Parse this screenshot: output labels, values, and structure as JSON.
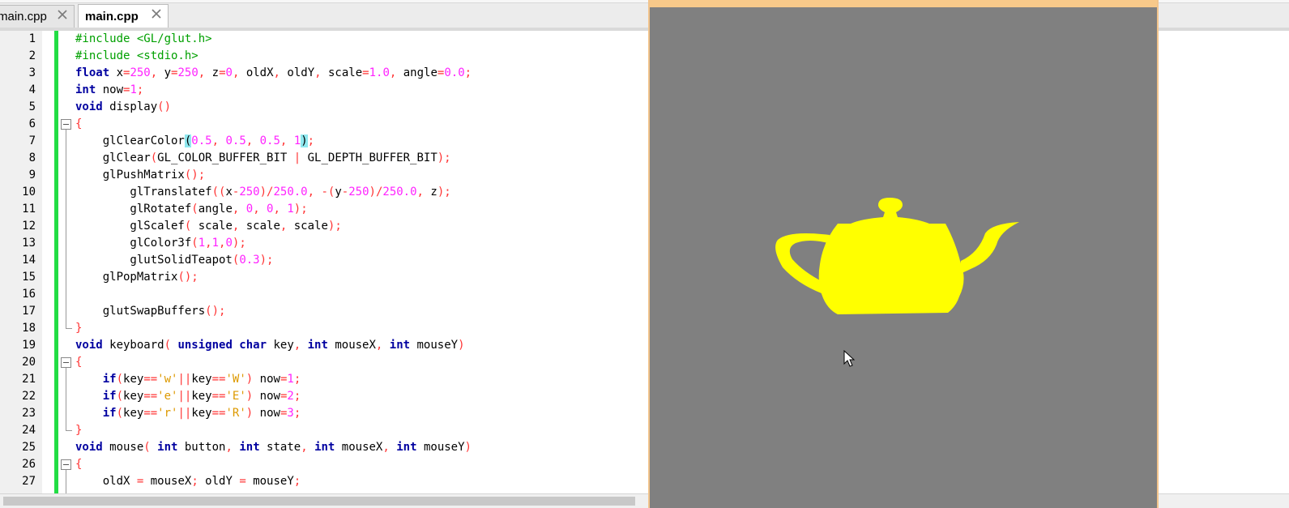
{
  "tabs": [
    {
      "label": "main.cpp",
      "state": "inactive"
    },
    {
      "label": "main.cpp",
      "state": "active"
    }
  ],
  "editor": {
    "lines": [
      {
        "n": "1",
        "tokens": [
          [
            "pp",
            "#include <GL/glut.h>"
          ]
        ]
      },
      {
        "n": "2",
        "tokens": [
          [
            "pp",
            "#include <stdio.h>"
          ]
        ]
      },
      {
        "n": "3",
        "tokens": [
          [
            "kw",
            "float"
          ],
          [
            "t",
            " x"
          ],
          [
            "op",
            "="
          ],
          [
            "num",
            "250"
          ],
          [
            "op",
            ","
          ],
          [
            "t",
            " y"
          ],
          [
            "op",
            "="
          ],
          [
            "num",
            "250"
          ],
          [
            "op",
            ","
          ],
          [
            "t",
            " z"
          ],
          [
            "op",
            "="
          ],
          [
            "num",
            "0"
          ],
          [
            "op",
            ","
          ],
          [
            "t",
            " oldX"
          ],
          [
            "op",
            ","
          ],
          [
            "t",
            " oldY"
          ],
          [
            "op",
            ","
          ],
          [
            "t",
            " scale"
          ],
          [
            "op",
            "="
          ],
          [
            "num",
            "1.0"
          ],
          [
            "op",
            ","
          ],
          [
            "t",
            " angle"
          ],
          [
            "op",
            "="
          ],
          [
            "num",
            "0.0"
          ],
          [
            "op",
            ";"
          ]
        ]
      },
      {
        "n": "4",
        "tokens": [
          [
            "kw",
            "int"
          ],
          [
            "t",
            " now"
          ],
          [
            "op",
            "="
          ],
          [
            "num",
            "1"
          ],
          [
            "op",
            ";"
          ]
        ]
      },
      {
        "n": "5",
        "tokens": [
          [
            "kw",
            "void"
          ],
          [
            "t",
            " display"
          ],
          [
            "op",
            "()"
          ]
        ]
      },
      {
        "n": "6",
        "tokens": [
          [
            "op",
            "{"
          ]
        ],
        "fold": "start"
      },
      {
        "n": "7",
        "tokens": [
          [
            "t",
            "    glClearColor"
          ],
          [
            "hl",
            "("
          ],
          [
            "num",
            "0.5"
          ],
          [
            "op",
            ","
          ],
          [
            "num",
            " 0.5"
          ],
          [
            "op",
            ","
          ],
          [
            "num",
            " 0.5"
          ],
          [
            "op",
            ","
          ],
          [
            "num",
            " 1"
          ],
          [
            "hl",
            ")"
          ],
          [
            "op",
            ";"
          ]
        ]
      },
      {
        "n": "8",
        "tokens": [
          [
            "t",
            "    glClear"
          ],
          [
            "op",
            "("
          ],
          [
            "t",
            "GL_COLOR_BUFFER_BIT "
          ],
          [
            "op",
            "|"
          ],
          [
            "t",
            " GL_DEPTH_BUFFER_BIT"
          ],
          [
            "op",
            ");"
          ]
        ]
      },
      {
        "n": "9",
        "tokens": [
          [
            "t",
            "    glPushMatrix"
          ],
          [
            "op",
            "();"
          ]
        ]
      },
      {
        "n": "10",
        "tokens": [
          [
            "t",
            "        glTranslatef"
          ],
          [
            "op",
            "(("
          ],
          [
            "t",
            "x"
          ],
          [
            "op",
            "-"
          ],
          [
            "num",
            "250"
          ],
          [
            "op",
            ")/"
          ],
          [
            "num",
            "250.0"
          ],
          [
            "op",
            ","
          ],
          [
            "op",
            " -("
          ],
          [
            "t",
            "y"
          ],
          [
            "op",
            "-"
          ],
          [
            "num",
            "250"
          ],
          [
            "op",
            ")/"
          ],
          [
            "num",
            "250.0"
          ],
          [
            "op",
            ","
          ],
          [
            "t",
            " z"
          ],
          [
            "op",
            ");"
          ]
        ]
      },
      {
        "n": "11",
        "tokens": [
          [
            "t",
            "        glRotatef"
          ],
          [
            "op",
            "("
          ],
          [
            "t",
            "angle"
          ],
          [
            "op",
            ","
          ],
          [
            "num",
            " 0"
          ],
          [
            "op",
            ","
          ],
          [
            "num",
            " 0"
          ],
          [
            "op",
            ","
          ],
          [
            "num",
            " 1"
          ],
          [
            "op",
            ");"
          ]
        ]
      },
      {
        "n": "12",
        "tokens": [
          [
            "t",
            "        glScalef"
          ],
          [
            "op",
            "("
          ],
          [
            "t",
            " scale"
          ],
          [
            "op",
            ","
          ],
          [
            "t",
            " scale"
          ],
          [
            "op",
            ","
          ],
          [
            "t",
            " scale"
          ],
          [
            "op",
            ");"
          ]
        ]
      },
      {
        "n": "13",
        "tokens": [
          [
            "t",
            "        glColor3f"
          ],
          [
            "op",
            "("
          ],
          [
            "num",
            "1"
          ],
          [
            "op",
            ","
          ],
          [
            "num",
            "1"
          ],
          [
            "op",
            ","
          ],
          [
            "num",
            "0"
          ],
          [
            "op",
            ");"
          ]
        ]
      },
      {
        "n": "14",
        "tokens": [
          [
            "t",
            "        glutSolidTeapot"
          ],
          [
            "op",
            "("
          ],
          [
            "num",
            "0.3"
          ],
          [
            "op",
            ");"
          ]
        ]
      },
      {
        "n": "15",
        "tokens": [
          [
            "t",
            "    glPopMatrix"
          ],
          [
            "op",
            "();"
          ]
        ]
      },
      {
        "n": "16",
        "tokens": []
      },
      {
        "n": "17",
        "tokens": [
          [
            "t",
            "    glutSwapBuffers"
          ],
          [
            "op",
            "();"
          ]
        ]
      },
      {
        "n": "18",
        "tokens": [
          [
            "op",
            "}"
          ]
        ],
        "fold": "end"
      },
      {
        "n": "19",
        "tokens": [
          [
            "kw",
            "void"
          ],
          [
            "t",
            " keyboard"
          ],
          [
            "op",
            "("
          ],
          [
            "kw",
            " unsigned char"
          ],
          [
            "t",
            " key"
          ],
          [
            "op",
            ","
          ],
          [
            "kw",
            " int"
          ],
          [
            "t",
            " mouseX"
          ],
          [
            "op",
            ","
          ],
          [
            "kw",
            " int"
          ],
          [
            "t",
            " mouseY"
          ],
          [
            "op",
            ")"
          ]
        ]
      },
      {
        "n": "20",
        "tokens": [
          [
            "op",
            "{"
          ]
        ],
        "fold": "start"
      },
      {
        "n": "21",
        "tokens": [
          [
            "kw",
            "    if"
          ],
          [
            "op",
            "("
          ],
          [
            "t",
            "key"
          ],
          [
            "op",
            "=="
          ],
          [
            "str",
            "'w'"
          ],
          [
            "op",
            "||"
          ],
          [
            "t",
            "key"
          ],
          [
            "op",
            "=="
          ],
          [
            "str",
            "'W'"
          ],
          [
            "op",
            ")"
          ],
          [
            "t",
            " now"
          ],
          [
            "op",
            "="
          ],
          [
            "num",
            "1"
          ],
          [
            "op",
            ";"
          ]
        ]
      },
      {
        "n": "22",
        "tokens": [
          [
            "kw",
            "    if"
          ],
          [
            "op",
            "("
          ],
          [
            "t",
            "key"
          ],
          [
            "op",
            "=="
          ],
          [
            "str",
            "'e'"
          ],
          [
            "op",
            "||"
          ],
          [
            "t",
            "key"
          ],
          [
            "op",
            "=="
          ],
          [
            "str",
            "'E'"
          ],
          [
            "op",
            ")"
          ],
          [
            "t",
            " now"
          ],
          [
            "op",
            "="
          ],
          [
            "num",
            "2"
          ],
          [
            "op",
            ";"
          ]
        ]
      },
      {
        "n": "23",
        "tokens": [
          [
            "kw",
            "    if"
          ],
          [
            "op",
            "("
          ],
          [
            "t",
            "key"
          ],
          [
            "op",
            "=="
          ],
          [
            "str",
            "'r'"
          ],
          [
            "op",
            "||"
          ],
          [
            "t",
            "key"
          ],
          [
            "op",
            "=="
          ],
          [
            "str",
            "'R'"
          ],
          [
            "op",
            ")"
          ],
          [
            "t",
            " now"
          ],
          [
            "op",
            "="
          ],
          [
            "num",
            "3"
          ],
          [
            "op",
            ";"
          ]
        ]
      },
      {
        "n": "24",
        "tokens": [
          [
            "op",
            "}"
          ]
        ],
        "fold": "end"
      },
      {
        "n": "25",
        "tokens": [
          [
            "kw",
            "void"
          ],
          [
            "t",
            " mouse"
          ],
          [
            "op",
            "("
          ],
          [
            "kw",
            " int"
          ],
          [
            "t",
            " button"
          ],
          [
            "op",
            ","
          ],
          [
            "kw",
            " int"
          ],
          [
            "t",
            " state"
          ],
          [
            "op",
            ","
          ],
          [
            "kw",
            " int"
          ],
          [
            "t",
            " mouseX"
          ],
          [
            "op",
            ","
          ],
          [
            "kw",
            " int"
          ],
          [
            "t",
            " mouseY"
          ],
          [
            "op",
            ")"
          ]
        ]
      },
      {
        "n": "26",
        "tokens": [
          [
            "op",
            "{"
          ]
        ],
        "fold": "start"
      },
      {
        "n": "27",
        "tokens": [
          [
            "t",
            "    oldX "
          ],
          [
            "op",
            "="
          ],
          [
            "t",
            " mouseX"
          ],
          [
            "op",
            ";"
          ],
          [
            "t",
            " oldY "
          ],
          [
            "op",
            "="
          ],
          [
            "t",
            " mouseY"
          ],
          [
            "op",
            ";"
          ]
        ]
      }
    ]
  },
  "gl_window": {
    "background": "#808080",
    "teapot_color": "#ffff00",
    "titlebar_color": "#f8c98a"
  },
  "colors": {
    "keyword": "#0000a0",
    "preprocessor": "#00a000",
    "number": "#ff22ff",
    "operator": "#ff3333",
    "string": "#dd9900",
    "brace_highlight": "#8fe8ef",
    "change_bar": "#22dd44"
  }
}
